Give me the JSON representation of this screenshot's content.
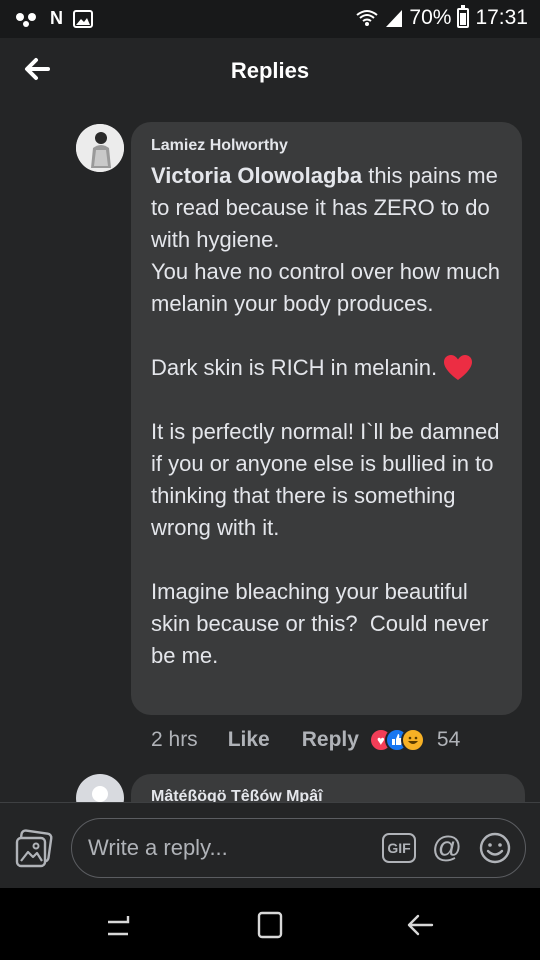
{
  "status_bar": {
    "notification_icons": [
      "voicemail-icon",
      "netflix-icon",
      "gallery-icon"
    ],
    "netflix_letter": "N",
    "battery": "70%",
    "time": "17:31"
  },
  "header": {
    "title": "Replies"
  },
  "comment": {
    "author": "Lamiez Holworthy",
    "mention": "Victoria Olowolagba",
    "text_part1": " this pains me to read because it has ZERO to do with hygiene.\nYou have no control over how much melanin your body produces.\n\nDark skin is RICH in melanin. ",
    "text_part2": "\n\nIt is perfectly normal! I`ll be damned if you or anyone else is bullied in to thinking that there is something wrong with it.\n\nImagine bleaching your beautiful skin because or this?  Could never be me.",
    "time": "2 hrs",
    "like_label": "Like",
    "reply_label": "Reply",
    "reactions": [
      "love",
      "like",
      "haha"
    ],
    "reaction_count": "54"
  },
  "next_comment": {
    "author": "Mâtéßögö Têßów Mpâî"
  },
  "composer": {
    "placeholder": "Write a reply...",
    "gif_label": "GIF",
    "at_label": "@"
  },
  "colors": {
    "background": "#242526",
    "bubble": "#3a3b3c",
    "love": "#f33e58",
    "like": "#1877f2",
    "haha": "#f7b125"
  }
}
